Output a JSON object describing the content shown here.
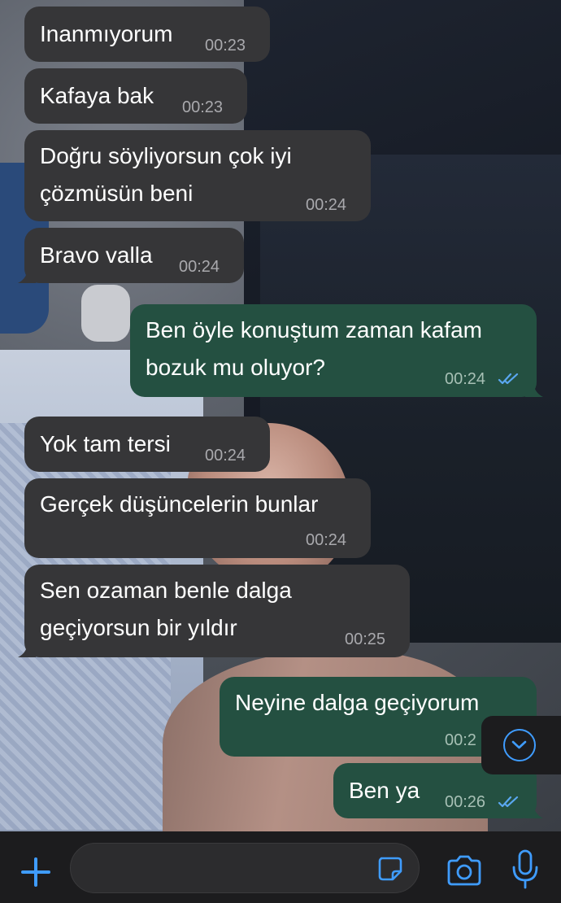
{
  "messages": [
    {
      "dir": "in",
      "lines": [
        "Inanmıyorum"
      ],
      "time": "00:23"
    },
    {
      "dir": "in",
      "lines": [
        "Kafaya bak"
      ],
      "time": "00:23"
    },
    {
      "dir": "in",
      "lines": [
        "Doğru söyliyorsun çok iyi",
        "çözmüsün beni"
      ],
      "time": "00:24"
    },
    {
      "dir": "in",
      "lines": [
        "Bravo valla"
      ],
      "time": "00:24"
    },
    {
      "dir": "out",
      "lines": [
        "Ben öyle konuştum zaman kafam",
        "bozuk mu oluyor?"
      ],
      "time": "00:24",
      "status": "read"
    },
    {
      "dir": "in",
      "lines": [
        "Yok tam tersi"
      ],
      "time": "00:24"
    },
    {
      "dir": "in",
      "lines": [
        "Gerçek düşüncelerin bunlar"
      ],
      "time": "00:24"
    },
    {
      "dir": "in",
      "lines": [
        "Sen ozaman benle dalga",
        "geçiyorsun bir yıldır"
      ],
      "time": "00:25"
    },
    {
      "dir": "out",
      "lines": [
        "Neyine dalga geçiyorum"
      ],
      "time": "00:2",
      "status": "read"
    },
    {
      "dir": "out",
      "lines": [
        "Ben ya"
      ],
      "time": "00:26",
      "status": "read"
    }
  ],
  "composer": {
    "placeholder": "",
    "value": ""
  },
  "icons": {
    "attach": "plus-icon",
    "sticker": "sticker-icon",
    "camera": "camera-icon",
    "mic": "microphone-icon",
    "scroll": "chevron-down-icon",
    "read": "double-check-icon"
  },
  "colors": {
    "incoming_bubble": "#363638",
    "outgoing_bubble": "#245041",
    "accent": "#3f9cff",
    "read_ticks": "#5aa7f0",
    "bar": "#1c1c1e"
  }
}
